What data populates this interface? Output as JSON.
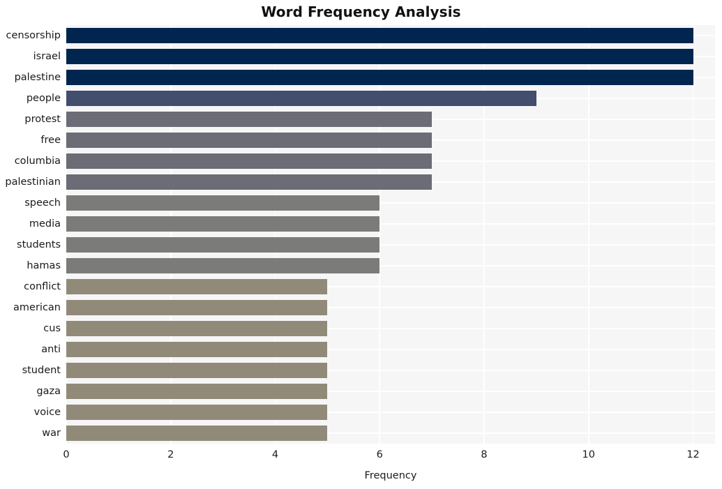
{
  "chart_data": {
    "type": "bar",
    "orientation": "horizontal",
    "title": "Word Frequency Analysis",
    "xlabel": "Frequency",
    "ylabel": "",
    "categories": [
      "censorship",
      "israel",
      "palestine",
      "people",
      "protest",
      "free",
      "columbia",
      "palestinian",
      "speech",
      "media",
      "students",
      "hamas",
      "conflict",
      "american",
      "cus",
      "anti",
      "student",
      "gaza",
      "voice",
      "war"
    ],
    "values": [
      12,
      12,
      12,
      9,
      7,
      7,
      7,
      7,
      6,
      6,
      6,
      6,
      5,
      5,
      5,
      5,
      5,
      5,
      5,
      5
    ],
    "bar_colors": [
      "#00264F",
      "#00264F",
      "#00264F",
      "#434D6E",
      "#6B6C75",
      "#6B6C75",
      "#6B6C75",
      "#6B6C75",
      "#7B7B79",
      "#7B7B79",
      "#7B7B79",
      "#7B7B79",
      "#918A79",
      "#918A79",
      "#918A79",
      "#918A79",
      "#918A79",
      "#918A79",
      "#918A79",
      "#918A79"
    ],
    "xlim": [
      0,
      12.42
    ],
    "xticks": [
      0,
      2,
      4,
      6,
      8,
      10,
      12
    ],
    "xtick_labels": [
      "0",
      "2",
      "4",
      "6",
      "8",
      "10",
      "12"
    ],
    "grid": true,
    "grid_color": "#ffffff",
    "plot_background": "#F6F6F7",
    "figure_background": "#FFFFFF",
    "legend": null
  }
}
